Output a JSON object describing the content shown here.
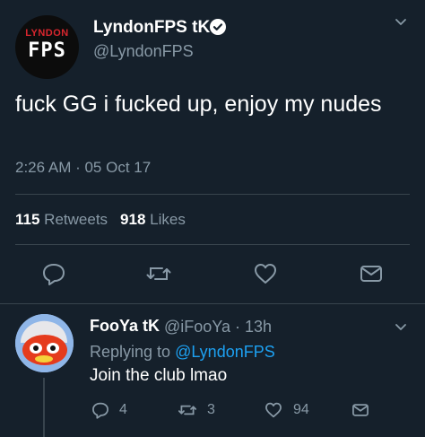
{
  "tweet": {
    "avatar_logo_top": "LYNDON",
    "avatar_logo_bottom": "FPS",
    "display_name": "LyndonFPS tK",
    "handle": "@LyndonFPS",
    "text": "fuck GG i fucked up, enjoy my nudes",
    "timestamp": "2:26 AM · 05 Oct 17",
    "retweets_count": "115",
    "retweets_label": "Retweets",
    "likes_count": "918",
    "likes_label": "Likes",
    "icons": [
      "reply-icon",
      "retweet-icon",
      "like-icon",
      "message-icon"
    ]
  },
  "reply": {
    "display_name": "FooYa tK",
    "handle_time": "@iFooYa · 13h",
    "replying_prefix": "Replying to ",
    "replying_handle": "@LyndonFPS",
    "text": "Join the club lmao",
    "reply_count": "4",
    "retweet_count": "3",
    "like_count": "94"
  },
  "colors": {
    "background": "#15202b",
    "secondary_text": "#8899a6",
    "link": "#1da1f2",
    "divider": "#38444d"
  }
}
